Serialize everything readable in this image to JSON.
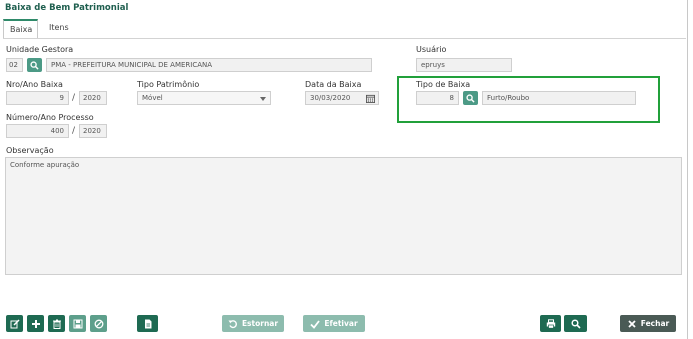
{
  "title": "Baixa de Bem Patrimonial",
  "tabs": [
    {
      "label": "Baixa"
    },
    {
      "label": "Itens"
    }
  ],
  "unidade_gestora": {
    "label": "Unidade Gestora",
    "code": "02",
    "name": "PMA - PREFEITURA MUNICIPAL DE AMERICANA"
  },
  "usuario": {
    "label": "Usuário",
    "value": "epruys"
  },
  "nro_ano_baixa": {
    "label": "Nro/Ano Baixa",
    "nro": "9",
    "sep": "/",
    "ano": "2020"
  },
  "tipo_patrimonio": {
    "label": "Tipo Patrimônio",
    "value": "Móvel"
  },
  "data_baixa": {
    "label": "Data da Baixa",
    "value": "30/03/2020"
  },
  "tipo_baixa": {
    "label": "Tipo de Baixa",
    "code": "8",
    "name": "Furto/Roubo"
  },
  "numero_ano_processo": {
    "label": "Número/Ano Processo",
    "numero": "400",
    "sep": "/",
    "ano": "2020"
  },
  "observacao": {
    "label": "Observação",
    "value": "Conforme apuração"
  },
  "toolbar": {
    "estornar_label": "Estornar",
    "efetivar_label": "Efetivar",
    "fechar_label": "Fechar"
  },
  "colors": {
    "brand_dark": "#1e6a52",
    "brand_mid": "#4c9a86",
    "highlight": "#21a03a",
    "close_button": "#4a5a55"
  }
}
